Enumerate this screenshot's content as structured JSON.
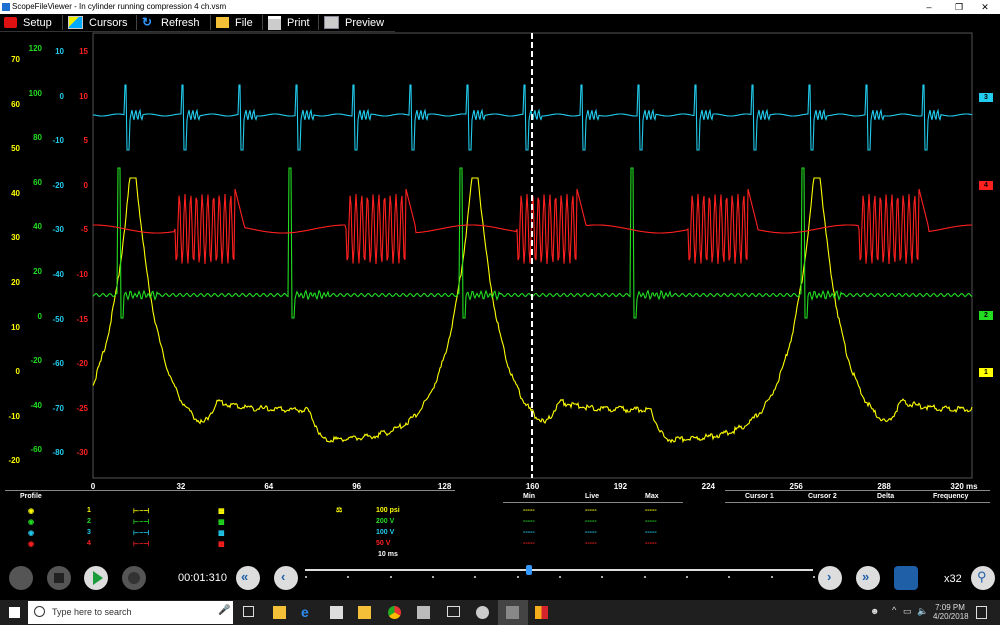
{
  "window": {
    "title": "ScopeFileViewer - In cylinder running compression 4 ch.vsm"
  },
  "toolbar": {
    "items": [
      {
        "label": "Setup",
        "icon": "camera-icon"
      },
      {
        "label": "Cursors",
        "icon": "cursors-icon"
      },
      {
        "label": "Refresh",
        "icon": "refresh-icon"
      },
      {
        "label": "File",
        "icon": "folder-icon"
      },
      {
        "label": "Print",
        "icon": "printer-icon"
      },
      {
        "label": "Preview",
        "icon": "preview-icon"
      }
    ]
  },
  "scales": {
    "ch1_yellow": [
      "70",
      "60",
      "50",
      "40",
      "30",
      "20",
      "10",
      "0",
      "-10",
      "-20"
    ],
    "ch2_green": [
      "120",
      "100",
      "80",
      "60",
      "40",
      "20",
      "0",
      "-20",
      "-40",
      "-60"
    ],
    "ch3_cyan": [
      "10",
      "0",
      "-10",
      "-20",
      "-30",
      "-40",
      "-50",
      "-60",
      "-70",
      "-80"
    ],
    "ch4_red": [
      "15",
      "10",
      "5",
      "0",
      "-5",
      "-10",
      "-15",
      "-20",
      "-25",
      "-30"
    ]
  },
  "channel_tags": [
    "3",
    "4",
    "2",
    "1"
  ],
  "x_axis": {
    "ticks": [
      "0",
      "32",
      "64",
      "96",
      "128",
      "160",
      "192",
      "224",
      "256",
      "288",
      "320 ms"
    ]
  },
  "info": {
    "profile_label": "Profile",
    "min_label": "Min",
    "live_label": "Live",
    "max_label": "Max",
    "cursor1_label": "Cursor 1",
    "cursor2_label": "Cursor 2",
    "delta_label": "Delta",
    "frequency_label": "Frequency",
    "channels": [
      {
        "num": "1",
        "scale": "100 psi",
        "color": "#ffff00",
        "min": "-----",
        "live": "-----",
        "max": "-----"
      },
      {
        "num": "2",
        "scale": "200 V",
        "color": "#22dd22",
        "min": "-----",
        "live": "-----",
        "max": "-----"
      },
      {
        "num": "3",
        "scale": "100 V",
        "color": "#22ccee",
        "min": "-----",
        "live": "-----",
        "max": "-----"
      },
      {
        "num": "4",
        "scale": "50 V",
        "color": "#ff2020",
        "min": "-----",
        "live": "-----",
        "max": "-----"
      }
    ],
    "timebase": "10 ms"
  },
  "transport": {
    "time": "00:01:310",
    "zoom": "x32",
    "position_fraction": 0.44
  },
  "taskbar": {
    "search_placeholder": "Type here to search",
    "time": "7:09 PM",
    "date": "4/20/2018"
  },
  "colors": {
    "ch1": "#ffff00",
    "ch2": "#22dd22",
    "ch3": "#22ccee",
    "ch4": "#ff2020"
  }
}
